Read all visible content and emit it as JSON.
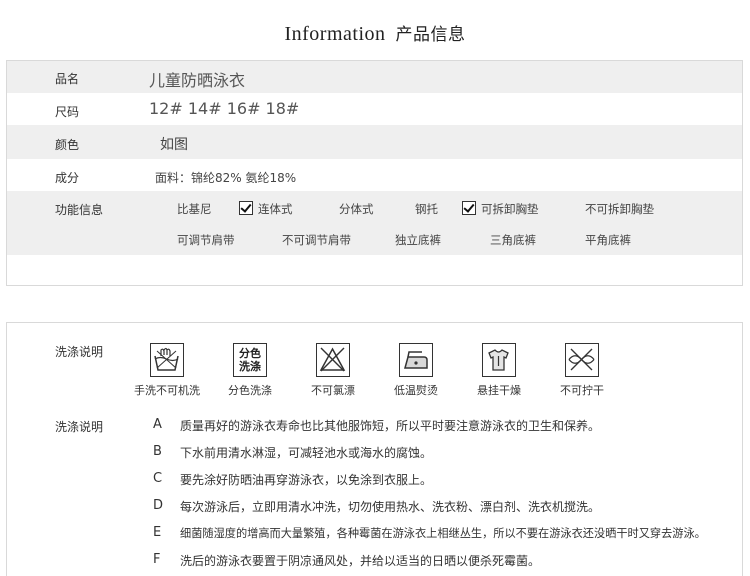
{
  "header": {
    "title_en": "Information",
    "title_cn": "产品信息"
  },
  "info": {
    "name": {
      "label": "品名",
      "value": "儿童防晒泳衣"
    },
    "size": {
      "label": "尺码",
      "value": "12# 14# 16# 18#"
    },
    "color": {
      "label": "颜色",
      "value": "如图"
    },
    "composition": {
      "label": "成分",
      "value": "面料：锦纶82% 氨纶18%"
    },
    "function": {
      "label": "功能信息",
      "row1": [
        {
          "text": "比基尼",
          "checked": false
        },
        {
          "text": "连体式",
          "checked": true
        },
        {
          "text": "分体式",
          "checked": false
        },
        {
          "text": "钢托",
          "checked": false
        },
        {
          "text": "可拆卸胸垫",
          "checked": true
        },
        {
          "text": "不可拆卸胸垫",
          "checked": false
        }
      ],
      "row2": [
        {
          "text": "可调节肩带"
        },
        {
          "text": "不可调节肩带"
        },
        {
          "text": "独立底裤"
        },
        {
          "text": "三角底裤"
        },
        {
          "text": "平角底裤"
        }
      ]
    }
  },
  "care": {
    "label": "洗涤说明",
    "icons": [
      {
        "name": "hand-wash-icon",
        "text": "手洗不可机洗"
      },
      {
        "name": "separate-wash-icon",
        "text": "分色洗涤",
        "inner": [
          "分色",
          "洗涤"
        ]
      },
      {
        "name": "no-bleach-icon",
        "text": "不可氯漂"
      },
      {
        "name": "low-iron-icon",
        "text": "低温熨烫"
      },
      {
        "name": "hang-dry-icon",
        "text": "悬挂干燥"
      },
      {
        "name": "no-wring-icon",
        "text": "不可拧干"
      }
    ]
  },
  "notes": {
    "label": "洗涤说明",
    "items": [
      {
        "letter": "A",
        "text": "质量再好的游泳衣寿命也比其他服饰短，所以平时要注意游泳衣的卫生和保养。"
      },
      {
        "letter": "B",
        "text": "下水前用清水淋湿，可减轻池水或海水的腐蚀。"
      },
      {
        "letter": "C",
        "text": "要先涂好防晒油再穿游泳衣，以免涂到衣服上。"
      },
      {
        "letter": "D",
        "text": "每次游泳后，立即用清水冲洗，切勿使用热水、洗衣粉、漂白剂、洗衣机搅洗。"
      },
      {
        "letter": "E",
        "text": "细菌随湿度的增高而大量繁殖，各种霉菌在游泳衣上相继丛生，所以不要在游泳衣还没晒干时又穿去游泳。"
      },
      {
        "letter": "F",
        "text": "洗后的游泳衣要置于阴凉通风处，并给以适当的日晒以便杀死霉菌。"
      }
    ]
  }
}
